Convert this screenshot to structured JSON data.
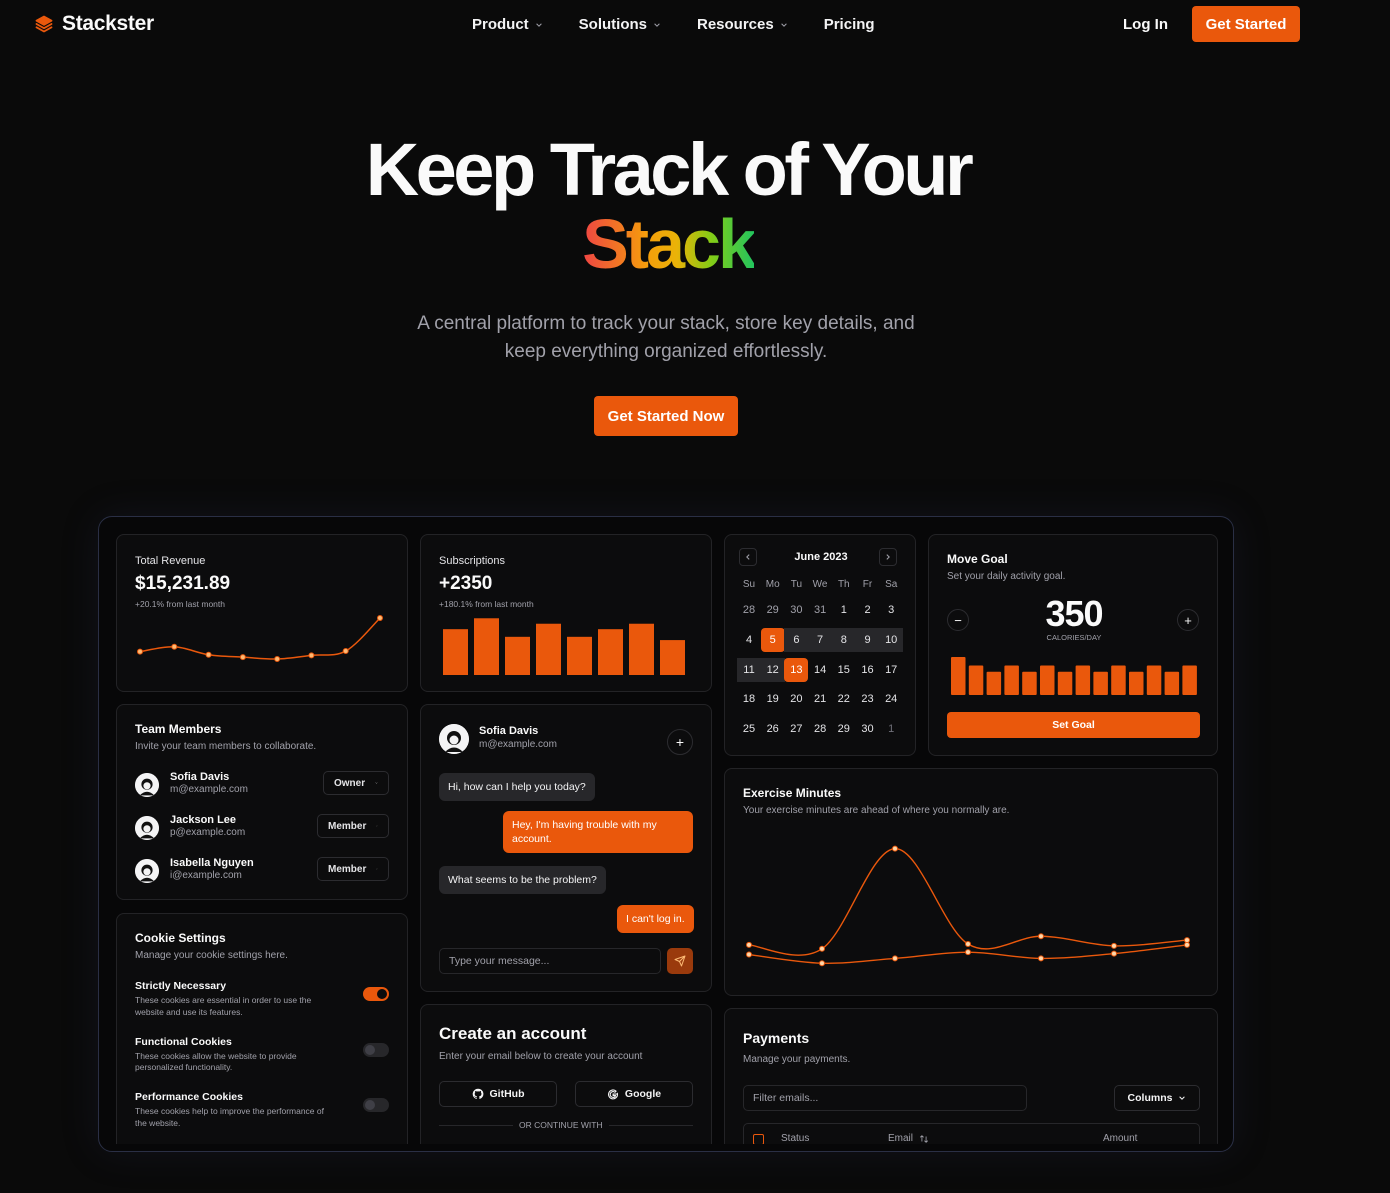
{
  "nav": {
    "brand": "Stackster",
    "links": [
      "Product",
      "Solutions",
      "Resources",
      "Pricing"
    ],
    "login": "Log In",
    "cta": "Get Started",
    "colors": {
      "accent": "#ea580c"
    }
  },
  "hero": {
    "title_line1": "Keep Track of Your",
    "title_line2": "Stack",
    "subtitle_line1": "A central platform to track your stack, store key details, and",
    "subtitle_line2": "keep everything organized effortlessly.",
    "cta": "Get Started Now"
  },
  "revenue": {
    "label": "Total Revenue",
    "value": "$15,231.89",
    "delta": "+20.1% from last month",
    "series": [
      3.0,
      3.8,
      2.5,
      2.1,
      1.8,
      2.4,
      3.1,
      8.5
    ]
  },
  "subscriptions": {
    "label": "Subscriptions",
    "value": "+2350",
    "delta": "+180.1% from last month",
    "bars": [
      42,
      52,
      35,
      47,
      35,
      42,
      47,
      32
    ]
  },
  "calendar": {
    "month": "June 2023",
    "weekdays": [
      "Su",
      "Mo",
      "Tu",
      "We",
      "Th",
      "Fr",
      "Sa"
    ],
    "weeks": [
      [
        "28",
        "29",
        "30",
        "31",
        "1",
        "2",
        "3"
      ],
      [
        "4",
        "5",
        "6",
        "7",
        "8",
        "9",
        "10"
      ],
      [
        "11",
        "12",
        "13",
        "14",
        "15",
        "16",
        "17"
      ],
      [
        "18",
        "19",
        "20",
        "21",
        "22",
        "23",
        "24"
      ],
      [
        "25",
        "26",
        "27",
        "28",
        "29",
        "30",
        "1"
      ]
    ]
  },
  "move_goal": {
    "title": "Move Goal",
    "subtitle": "Set your daily activity goal.",
    "value": "350",
    "unit": "CALORIES/DAY",
    "button": "Set Goal",
    "bars": [
      36,
      28,
      22,
      28,
      22,
      28,
      22,
      28,
      22,
      28,
      22,
      28,
      22,
      28
    ]
  },
  "team": {
    "title": "Team Members",
    "subtitle": "Invite your team members to collaborate.",
    "members": [
      {
        "name": "Sofia Davis",
        "email": "m@example.com",
        "role": "Owner"
      },
      {
        "name": "Jackson Lee",
        "email": "p@example.com",
        "role": "Member"
      },
      {
        "name": "Isabella Nguyen",
        "email": "i@example.com",
        "role": "Member"
      }
    ]
  },
  "chat": {
    "name": "Sofia Davis",
    "email": "m@example.com",
    "messages": [
      {
        "from": "in",
        "text": "Hi, how can I help you today?"
      },
      {
        "from": "out",
        "text": "Hey, I'm having trouble with my account."
      },
      {
        "from": "in",
        "text": "What seems to be the problem?"
      },
      {
        "from": "out",
        "text": "I can't log in."
      }
    ],
    "placeholder": "Type your message..."
  },
  "exercise": {
    "title": "Exercise Minutes",
    "subtitle": "Your exercise minutes are ahead of where you normally are.",
    "series_a": [
      50,
      42,
      250,
      52,
      68,
      48,
      60
    ],
    "series_b": [
      30,
      12,
      22,
      35,
      22,
      32,
      50
    ]
  },
  "cookies": {
    "title": "Cookie Settings",
    "subtitle": "Manage your cookie settings here.",
    "items": [
      {
        "title": "Strictly Necessary",
        "line1": "These cookies are essential in order to use the",
        "line2": "website and use its features.",
        "on": true
      },
      {
        "title": "Functional Cookies",
        "line1": "These cookies allow the website to provide",
        "line2": "personalized functionality.",
        "on": false
      },
      {
        "title": "Performance Cookies",
        "line1": "These cookies help to improve the performance of",
        "line2": "the website.",
        "on": false
      }
    ]
  },
  "account": {
    "title": "Create an account",
    "subtitle": "Enter your email below to create your account",
    "github": "GitHub",
    "google": "Google",
    "divider": "OR CONTINUE WITH"
  },
  "payments": {
    "title": "Payments",
    "subtitle": "Manage your payments.",
    "filter_placeholder": "Filter emails...",
    "columns_button": "Columns",
    "headers": [
      "Status",
      "Email",
      "Amount"
    ]
  }
}
